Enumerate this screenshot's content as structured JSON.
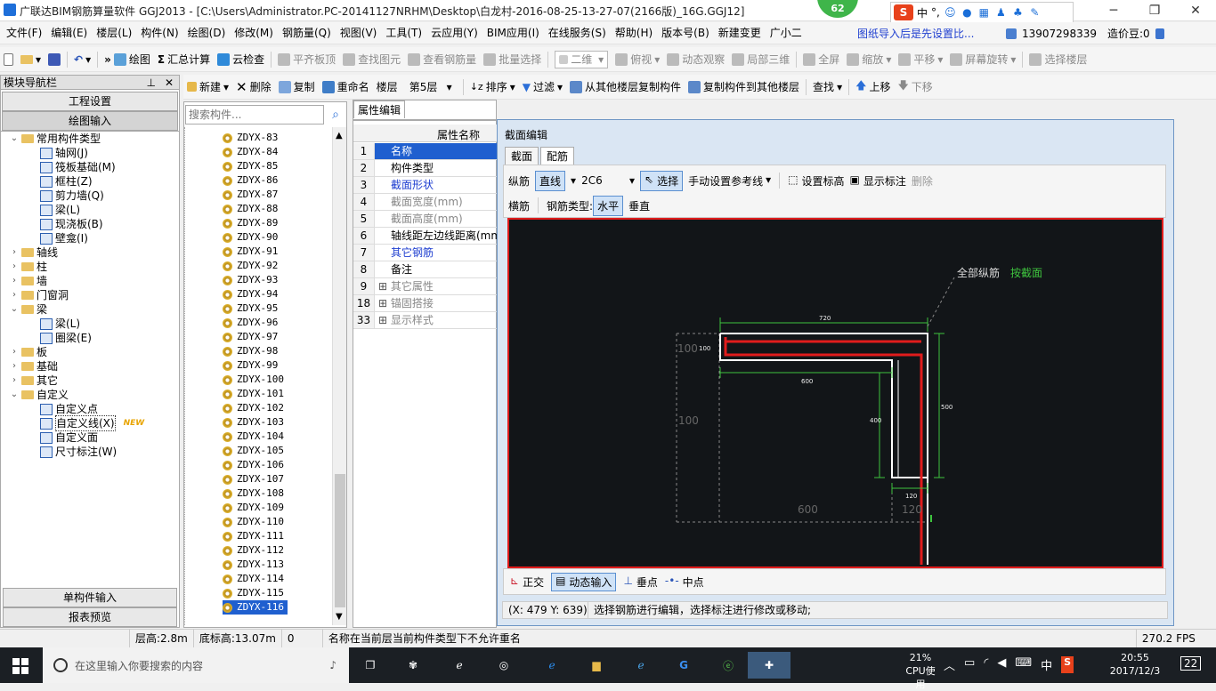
{
  "window": {
    "title": "广联达BIM钢筋算量软件 GGJ2013 - [C:\\Users\\Administrator.PC-20141127NRHM\\Desktop\\白龙村-2016-08-25-13-27-07(2166版)_16G.GGJ12]",
    "badge": "62",
    "ime": {
      "logo": "S",
      "lang": "中",
      "punct": "°,"
    }
  },
  "menu": [
    "文件(F)",
    "编辑(E)",
    "楼层(L)",
    "构件(N)",
    "绘图(D)",
    "修改(M)",
    "钢筋量(Q)",
    "视图(V)",
    "工具(T)",
    "云应用(Y)",
    "BIM应用(I)",
    "在线服务(S)",
    "帮助(H)",
    "版本号(B)",
    "新建变更",
    "广小二"
  ],
  "menu_right": {
    "notice": "图纸导入后是先设置比...",
    "phone": "13907298339",
    "bean": "造价豆:0"
  },
  "toolbar1": {
    "draw": "绘图",
    "sum": "汇总计算",
    "cloud_check": "云检查",
    "align": "平齐板顶",
    "find": "查找图元",
    "view_rebar": "查看钢筋量",
    "batch": "批量选择",
    "view_mode": "二维",
    "top_view": "俯视",
    "dynamic": "动态观察",
    "local3d": "局部三维",
    "fullscreen": "全屏",
    "zoom": "缩放",
    "pan": "平移",
    "rotate": "屏幕旋转",
    "select_floor": "选择楼层"
  },
  "toolbar2": {
    "new": "新建",
    "delete": "删除",
    "copy": "复制",
    "rename": "重命名",
    "floor_label": "楼层",
    "floor_value": "第5层",
    "sort": "排序",
    "filter": "过滤",
    "copy_from": "从其他楼层复制构件",
    "copy_to": "复制构件到其他楼层",
    "find": "查找",
    "up": "上移",
    "down": "下移"
  },
  "leftnav": {
    "header": "模块导航栏",
    "btn_project": "工程设置",
    "btn_draw": "绘图输入",
    "btn_single": "单构件输入",
    "btn_report": "报表预览",
    "new_tag": "NEW",
    "tree": [
      {
        "label": "常用构件类型",
        "level": 0,
        "type": "folder",
        "tog": "⌄"
      },
      {
        "label": "轴网(J)",
        "level": 1,
        "type": "item"
      },
      {
        "label": "筏板基础(M)",
        "level": 1,
        "type": "item"
      },
      {
        "label": "框柱(Z)",
        "level": 1,
        "type": "item"
      },
      {
        "label": "剪力墙(Q)",
        "level": 1,
        "type": "item"
      },
      {
        "label": "梁(L)",
        "level": 1,
        "type": "item"
      },
      {
        "label": "现浇板(B)",
        "level": 1,
        "type": "item"
      },
      {
        "label": "壁龛(I)",
        "level": 1,
        "type": "item"
      },
      {
        "label": "轴线",
        "level": 0,
        "type": "folder",
        "tog": "›"
      },
      {
        "label": "柱",
        "level": 0,
        "type": "folder",
        "tog": "›"
      },
      {
        "label": "墙",
        "level": 0,
        "type": "folder",
        "tog": "›"
      },
      {
        "label": "门窗洞",
        "level": 0,
        "type": "folder",
        "tog": "›"
      },
      {
        "label": "梁",
        "level": 0,
        "type": "folder",
        "tog": "⌄"
      },
      {
        "label": "梁(L)",
        "level": 1,
        "type": "item"
      },
      {
        "label": "圈梁(E)",
        "level": 1,
        "type": "item"
      },
      {
        "label": "板",
        "level": 0,
        "type": "folder",
        "tog": "›"
      },
      {
        "label": "基础",
        "level": 0,
        "type": "folder",
        "tog": "›"
      },
      {
        "label": "其它",
        "level": 0,
        "type": "folder",
        "tog": "›"
      },
      {
        "label": "自定义",
        "level": 0,
        "type": "folder",
        "tog": "⌄"
      },
      {
        "label": "自定义点",
        "level": 1,
        "type": "item"
      },
      {
        "label": "自定义线(X)",
        "level": 1,
        "type": "item",
        "selected": true
      },
      {
        "label": "自定义面",
        "level": 1,
        "type": "item"
      },
      {
        "label": "尺寸标注(W)",
        "level": 1,
        "type": "item"
      }
    ]
  },
  "complist": {
    "search_placeholder": "搜索构件...",
    "items": [
      "ZDYX-83",
      "ZDYX-84",
      "ZDYX-85",
      "ZDYX-86",
      "ZDYX-87",
      "ZDYX-88",
      "ZDYX-89",
      "ZDYX-90",
      "ZDYX-91",
      "ZDYX-92",
      "ZDYX-93",
      "ZDYX-94",
      "ZDYX-95",
      "ZDYX-96",
      "ZDYX-97",
      "ZDYX-98",
      "ZDYX-99",
      "ZDYX-100",
      "ZDYX-101",
      "ZDYX-102",
      "ZDYX-103",
      "ZDYX-104",
      "ZDYX-105",
      "ZDYX-106",
      "ZDYX-107",
      "ZDYX-108",
      "ZDYX-109",
      "ZDYX-110",
      "ZDYX-111",
      "ZDYX-112",
      "ZDYX-113",
      "ZDYX-114",
      "ZDYX-115",
      "ZDYX-116"
    ],
    "selected": "ZDYX-116"
  },
  "props": {
    "tab": "属性编辑",
    "header": "属性名称",
    "rows": [
      {
        "no": "1",
        "label": "名称",
        "color": "#000",
        "selected": true
      },
      {
        "no": "2",
        "label": "构件类型",
        "color": "#000"
      },
      {
        "no": "3",
        "label": "截面形状",
        "color": "#1f3fd0"
      },
      {
        "no": "4",
        "label": "截面宽度(mm)",
        "color": "#888"
      },
      {
        "no": "5",
        "label": "截面高度(mm)",
        "color": "#888"
      },
      {
        "no": "6",
        "label": "轴线距左边线距离(mm)",
        "color": "#000"
      },
      {
        "no": "7",
        "label": "其它钢筋",
        "color": "#1f3fd0"
      },
      {
        "no": "8",
        "label": "备注",
        "color": "#000"
      },
      {
        "no": "9",
        "label": "其它属性",
        "color": "#888",
        "expand": true
      },
      {
        "no": "18",
        "label": "锚固搭接",
        "color": "#888",
        "expand": true
      },
      {
        "no": "33",
        "label": "显示样式",
        "color": "#888",
        "expand": true
      }
    ]
  },
  "dialog": {
    "title": "截面编辑",
    "tabs": [
      "截面",
      "配筋"
    ],
    "active_tab": "配筋",
    "row1": {
      "long": "纵筋",
      "line": "直线",
      "spec": "2C6",
      "select": "选择",
      "manual_ref": "手动设置参考线",
      "set_elev": "设置标高",
      "show_dim": "显示标注",
      "delete": "删除"
    },
    "row2": {
      "trans": "横筋",
      "rebar_type": "钢筋类型:",
      "horizontal": "水平",
      "vertical": "垂直"
    },
    "canvas": {
      "label_all": "全部纵筋",
      "label_section": "按截面",
      "dims": {
        "top": "720",
        "left_small": "100",
        "left_big": "100",
        "mid": "600",
        "right_inner": "400",
        "right_outer": "500",
        "bottom_small": "120",
        "bottom_big_mid": "600",
        "bottom_big_right": "120"
      }
    },
    "bottom": {
      "ortho": "正交",
      "dynamic_input": "动态输入",
      "perp": "垂点",
      "mid": "中点"
    },
    "status_coord": "(X: 479 Y: 639)",
    "status_msg": "选择钢筋进行编辑，选择标注进行修改或移动;"
  },
  "statusbar": {
    "floor_h": "层高:2.8m",
    "bottom_h": "底标高:13.07m",
    "zero": "0",
    "msg": "名称在当前层当前构件类型下不允许重名",
    "fps": "270.2 FPS"
  },
  "taskbar": {
    "search_placeholder": "在这里输入你要搜索的内容",
    "cpu_pct": "21%",
    "cpu_label": "CPU使用",
    "ime": "中",
    "time": "20:55",
    "date": "2017/12/3",
    "notif": "22"
  },
  "colors": {
    "accent": "#1f5fcf",
    "canvas_bg": "#121518",
    "canvas_border": "#e01c1c",
    "dim_green": "#3ec43e",
    "rebar_red": "#e01c1c"
  }
}
